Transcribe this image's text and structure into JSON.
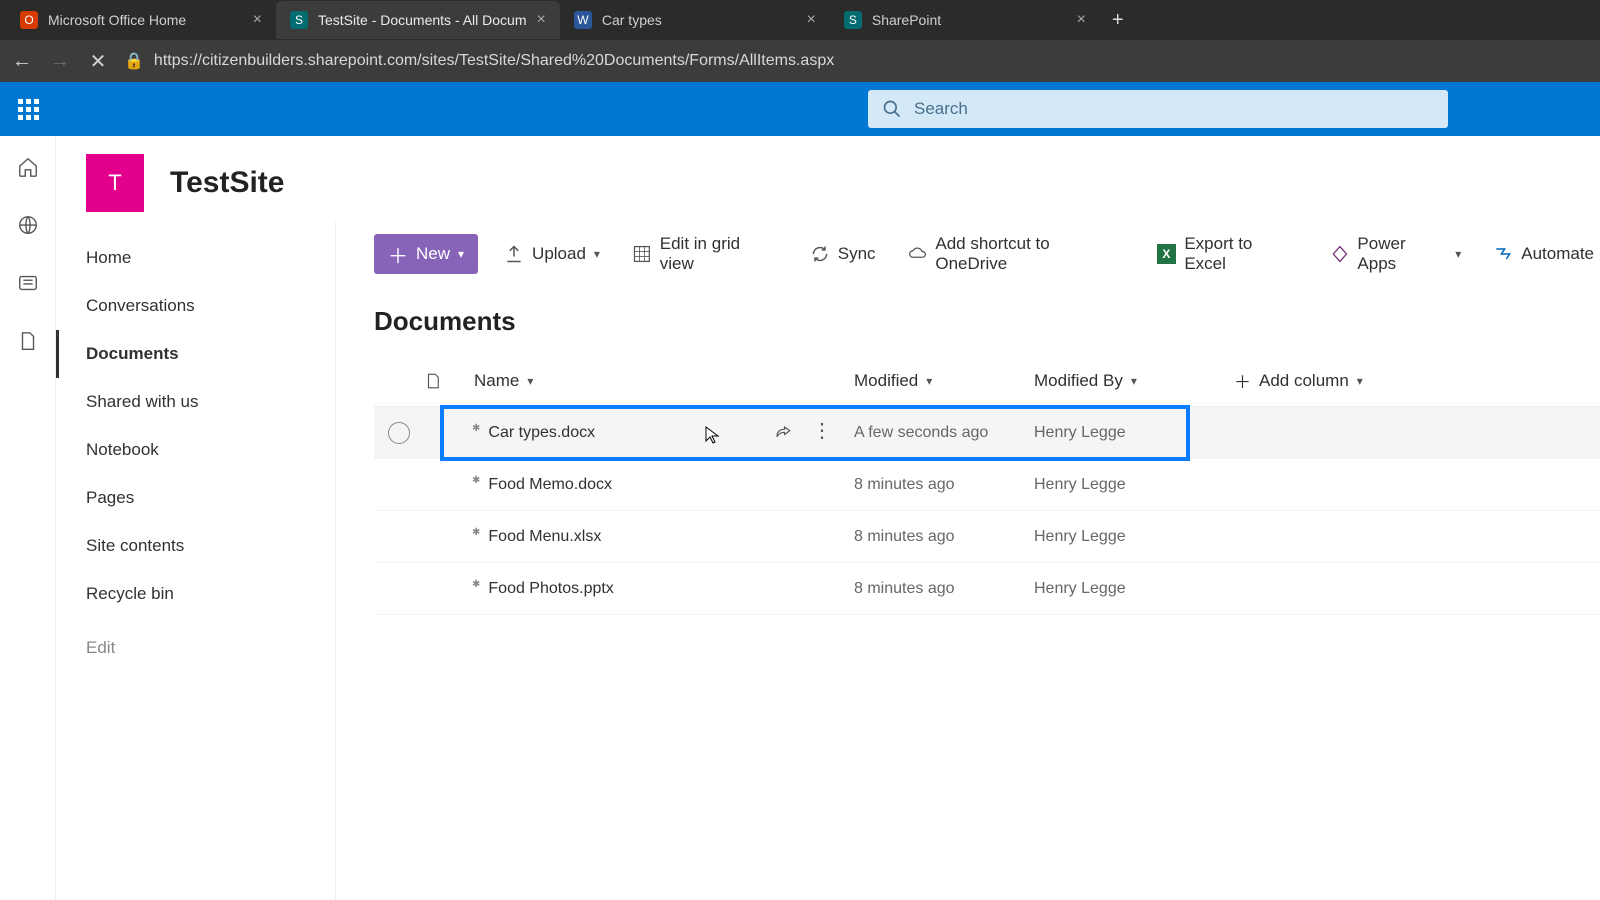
{
  "browser": {
    "tabs": [
      {
        "title": "Microsoft Office Home",
        "favicon": "office",
        "active": false
      },
      {
        "title": "TestSite - Documents - All Docum",
        "favicon": "sharepoint",
        "active": true
      },
      {
        "title": "Car types",
        "favicon": "word",
        "active": false
      },
      {
        "title": "SharePoint",
        "favicon": "sharepoint-green",
        "active": false
      }
    ],
    "url": "https://citizenbuilders.sharepoint.com/sites/TestSite/Shared%20Documents/Forms/AllItems.aspx"
  },
  "suite": {
    "search_placeholder": "Search"
  },
  "site": {
    "logo_letter": "T",
    "title": "TestSite",
    "nav": [
      {
        "label": "Home"
      },
      {
        "label": "Conversations"
      },
      {
        "label": "Documents",
        "active": true
      },
      {
        "label": "Shared with us"
      },
      {
        "label": "Notebook"
      },
      {
        "label": "Pages"
      },
      {
        "label": "Site contents"
      },
      {
        "label": "Recycle bin"
      }
    ],
    "edit_label": "Edit"
  },
  "commands": {
    "new": "New",
    "upload": "Upload",
    "grid": "Edit in grid view",
    "sync": "Sync",
    "shortcut": "Add shortcut to OneDrive",
    "export": "Export to Excel",
    "powerapps": "Power Apps",
    "automate": "Automate"
  },
  "library": {
    "title": "Documents",
    "columns": {
      "name": "Name",
      "modified": "Modified",
      "modified_by": "Modified By",
      "add": "Add column"
    },
    "rows": [
      {
        "name": "Car types.docx",
        "modified": "A few seconds ago",
        "modified_by": "Henry Legge",
        "hover": true
      },
      {
        "name": "Food Memo.docx",
        "modified": "8 minutes ago",
        "modified_by": "Henry Legge"
      },
      {
        "name": "Food Menu.xlsx",
        "modified": "8 minutes ago",
        "modified_by": "Henry Legge"
      },
      {
        "name": "Food Photos.pptx",
        "modified": "8 minutes ago",
        "modified_by": "Henry Legge"
      }
    ]
  }
}
